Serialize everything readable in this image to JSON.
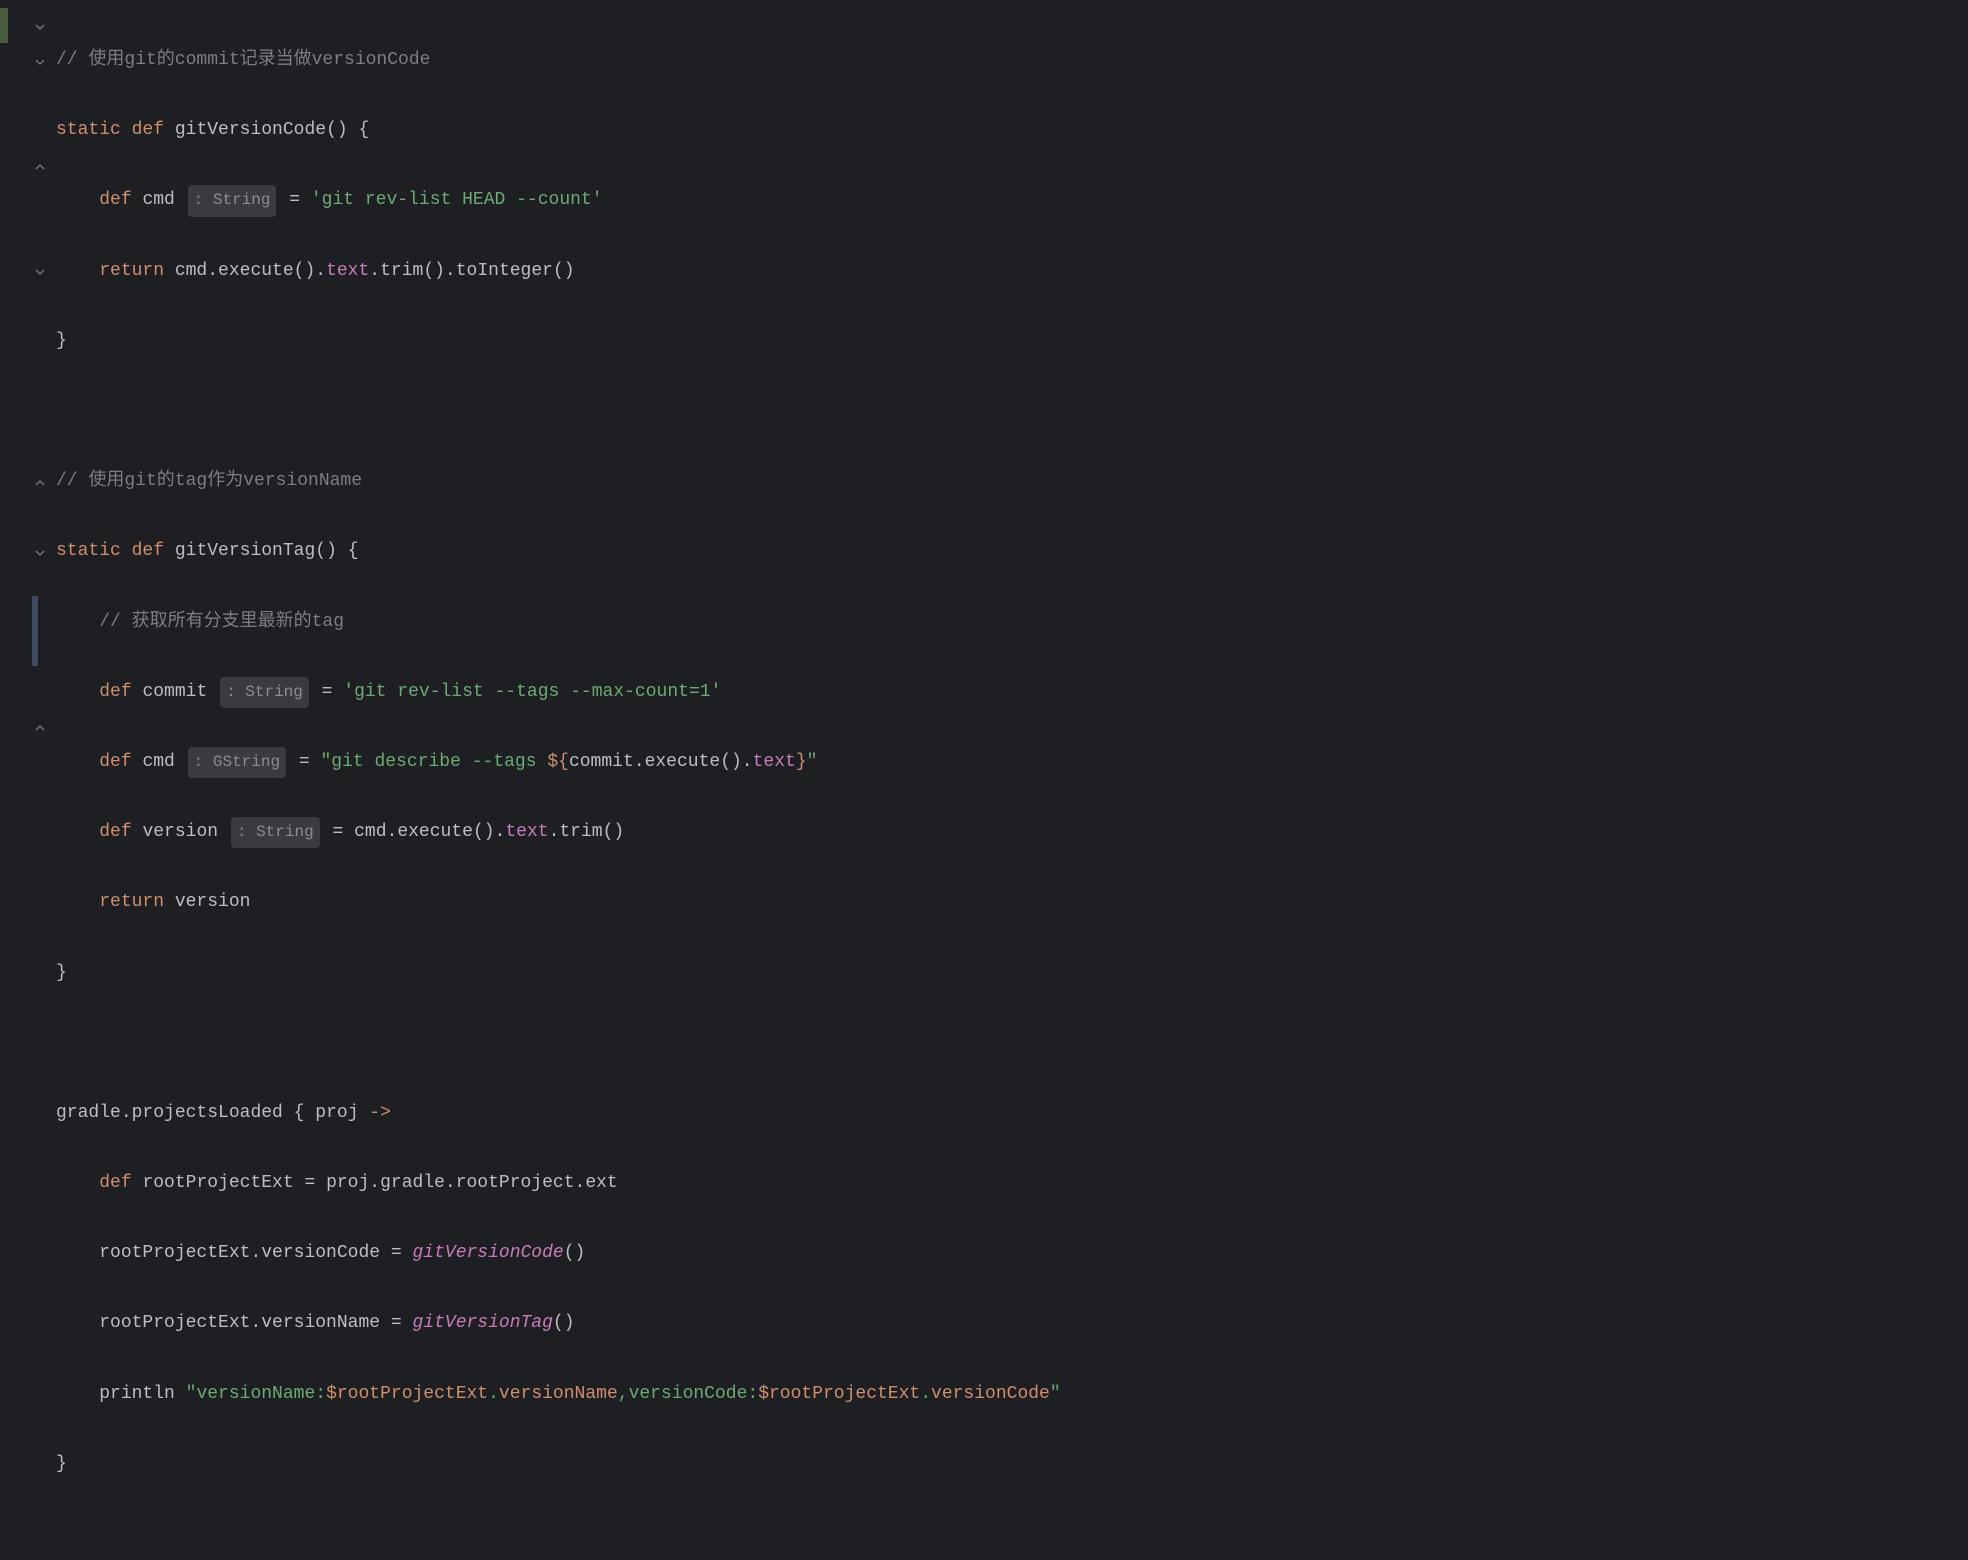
{
  "code": {
    "line1": {
      "comment": "// 使用git的commit记录当做versionCode"
    },
    "line2": {
      "static": "static",
      "def": "def",
      "name": "gitVersionCode",
      "parens": "()",
      "brace": " {"
    },
    "line3": {
      "def": "def",
      "var": "cmd",
      "type_prefix": ": ",
      "type": "String",
      "assign": " = ",
      "string": "'git rev-list HEAD --count'"
    },
    "line4": {
      "return": "return",
      "expr1": " cmd.",
      "execute": "execute",
      "expr2": "().",
      "text": "text",
      "expr3": ".",
      "trim": "trim",
      "expr4": "().",
      "toInt": "toInteger",
      "expr5": "()"
    },
    "line5": {
      "brace": "}"
    },
    "line7": {
      "comment": "// 使用git的tag作为versionName"
    },
    "line8": {
      "static": "static",
      "def": "def",
      "name": "gitVersionTag",
      "parens": "()",
      "brace": " {"
    },
    "line9": {
      "comment": "// 获取所有分支里最新的tag"
    },
    "line10": {
      "def": "def",
      "var": "commit",
      "type_prefix": ": ",
      "type": "String",
      "assign": " = ",
      "string": "'git rev-list --tags --max-count=1'"
    },
    "line11": {
      "def": "def",
      "var": "cmd",
      "type_prefix": ": ",
      "type": "GString",
      "assign": " = ",
      "string1": "\"git describe --tags ",
      "interp_start": "${",
      "interp_var1": "commit.",
      "interp_execute": "execute",
      "interp_var2": "().",
      "interp_text": "text",
      "interp_end": "}",
      "string2": "\""
    },
    "line12": {
      "def": "def",
      "var": "version",
      "type_prefix": ": ",
      "type": "String",
      "assign": " = cmd.",
      "execute": "execute",
      "expr1": "().",
      "text": "text",
      "expr2": ".",
      "trim": "trim",
      "expr3": "()"
    },
    "line13": {
      "return": "return",
      "var": " version"
    },
    "line14": {
      "brace": "}"
    },
    "line16": {
      "gradle": "gradle",
      "dot": ".",
      "method": "projectsLoaded",
      "space": " ",
      "brace": "{",
      "param": " proj ",
      "arrow": "->"
    },
    "line17": {
      "def": "def",
      "var": "rootProjectExt",
      "assign": " = proj.gradle.rootProject.ext"
    },
    "line18": {
      "expr1": "rootProjectExt.versionCode = ",
      "call": "gitVersionCode",
      "parens": "()"
    },
    "line19": {
      "expr1": "rootProjectExt.versionName = ",
      "call": "gitVersionTag",
      "parens": "()"
    },
    "line20": {
      "println": "println ",
      "s1": "\"versionName:",
      "i1": "$rootProjectExt",
      "s2": ".",
      "i2": "versionName",
      "s3": ",",
      "i3": "versionCode:",
      "i4": "$rootProjectExt",
      "s4": ".",
      "i5": "versionCode",
      "s5": "\""
    },
    "line21": {
      "brace": "}"
    }
  }
}
